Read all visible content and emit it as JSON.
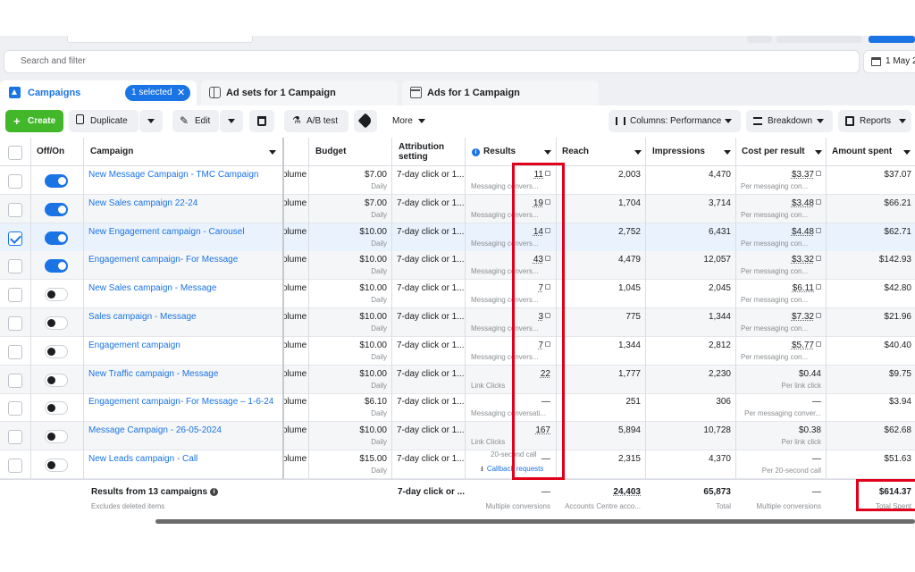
{
  "search": {
    "placeholder": "Search and filter",
    "date_label": "1 May 2"
  },
  "tabs": {
    "campaigns": "Campaigns",
    "selected_badge": "1 selected",
    "close_symbol": "✕",
    "adsets": "Ad sets for 1 Campaign",
    "ads": "Ads for 1 Campaign"
  },
  "toolbar": {
    "create": "Create",
    "duplicate": "Duplicate",
    "edit": "Edit",
    "ab_test": "A/B test",
    "more": "More",
    "columns": "Columns: Performance",
    "breakdown": "Breakdown",
    "reports": "Reports"
  },
  "headers": {
    "offon": "Off/On",
    "campaign": "Campaign",
    "budget": "Budget",
    "attribution": "Attribution setting",
    "results": "Results",
    "reach": "Reach",
    "impressions": "Impressions",
    "cost": "Cost per result",
    "amount": "Amount spent"
  },
  "rows": [
    {
      "name": "New Message Campaign - TMC Campaign",
      "toggle": true,
      "checked": false,
      "obj": "olume",
      "budget": "$7.00",
      "budget_type": "Daily",
      "attribution": "7-day click or 1...",
      "results": "11",
      "results_sub": "Messaging convers...",
      "reach": "2,003",
      "impressions": "4,470",
      "cost": "$3.37",
      "cost_sub": "Per messaging con...",
      "amount": "$37.07"
    },
    {
      "name": "New Sales campaign 22-24",
      "toggle": true,
      "checked": false,
      "obj": "olume",
      "budget": "$7.00",
      "budget_type": "Daily",
      "attribution": "7-day click or 1...",
      "results": "19",
      "results_sub": "Messaging convers...",
      "reach": "1,704",
      "impressions": "3,714",
      "cost": "$3.48",
      "cost_sub": "Per messaging con...",
      "amount": "$66.21"
    },
    {
      "name": "New Engagement campaign - Carousel",
      "toggle": true,
      "checked": true,
      "obj": "olume",
      "budget": "$10.00",
      "budget_type": "Daily",
      "attribution": "7-day click or 1...",
      "results": "14",
      "results_sub": "Messaging convers...",
      "reach": "2,752",
      "impressions": "6,431",
      "cost": "$4.48",
      "cost_sub": "Per messaging con...",
      "amount": "$62.71"
    },
    {
      "name": "Engagement campaign- For Message",
      "toggle": true,
      "checked": false,
      "obj": "olume",
      "budget": "$10.00",
      "budget_type": "Daily",
      "attribution": "7-day click or 1...",
      "results": "43",
      "results_sub": "Messaging convers...",
      "reach": "4,479",
      "impressions": "12,057",
      "cost": "$3.32",
      "cost_sub": "Per messaging con...",
      "amount": "$142.93"
    },
    {
      "name": "New Sales campaign - Message",
      "toggle": false,
      "checked": false,
      "obj": "olume",
      "budget": "$10.00",
      "budget_type": "Daily",
      "attribution": "7-day click or 1...",
      "results": "7",
      "results_sub": "Messaging convers...",
      "reach": "1,045",
      "impressions": "2,045",
      "cost": "$6.11",
      "cost_sub": "Per messaging con...",
      "amount": "$42.80"
    },
    {
      "name": "Sales campaign - Message",
      "toggle": false,
      "checked": false,
      "obj": "olume",
      "budget": "$10.00",
      "budget_type": "Daily",
      "attribution": "7-day click or 1...",
      "results": "3",
      "results_sub": "Messaging convers...",
      "reach": "775",
      "impressions": "1,344",
      "cost": "$7.32",
      "cost_sub": "Per messaging con...",
      "amount": "$21.96"
    },
    {
      "name": "Engagement campaign",
      "toggle": false,
      "checked": false,
      "obj": "olume",
      "budget": "$10.00",
      "budget_type": "Daily",
      "attribution": "7-day click or 1...",
      "results": "7",
      "results_sub": "Messaging convers...",
      "reach": "1,344",
      "impressions": "2,812",
      "cost": "$5.77",
      "cost_sub": "Per messaging con...",
      "amount": "$40.40"
    },
    {
      "name": "New Traffic campaign - Message",
      "toggle": false,
      "checked": false,
      "obj": "olume",
      "budget": "$10.00",
      "budget_type": "Daily",
      "attribution": "7-day click or 1...",
      "results": "22",
      "results_sub": "Link Clicks",
      "reach": "1,777",
      "impressions": "2,230",
      "cost": "$0.44",
      "cost_sub": "Per link click",
      "amount": "$9.75"
    },
    {
      "name": "Engagement campaign- For Message – 1-6-24",
      "toggle": false,
      "checked": false,
      "obj": "olume",
      "budget": "$6.10",
      "budget_type": "Daily",
      "attribution": "7-day click or 1...",
      "results": "—",
      "results_sub": "Messaging conversati...",
      "reach": "251",
      "impressions": "306",
      "cost": "—",
      "cost_sub": "Per messaging conver...",
      "amount": "$3.94"
    },
    {
      "name": "Message Campaign - 26-05-2024",
      "toggle": false,
      "checked": false,
      "obj": "olume",
      "budget": "$10.00",
      "budget_type": "Daily",
      "attribution": "7-day click or 1...",
      "results": "167",
      "results_sub": "Link Clicks",
      "reach": "5,894",
      "impressions": "10,728",
      "cost": "$0.38",
      "cost_sub": "Per link click",
      "amount": "$62.68"
    },
    {
      "name": "New Leads campaign - Call",
      "toggle": false,
      "checked": false,
      "obj": "olume",
      "budget": "$15.00",
      "budget_type": "Daily",
      "attribution": "7-day click or 1...",
      "results": "—",
      "results_sub": "20-second call",
      "results_extra": "Callback requests",
      "reach": "2,315",
      "impressions": "4,370",
      "cost": "—",
      "cost_sub": "Per 20-second call",
      "amount": "$51.63"
    }
  ],
  "totals": {
    "label": "Results from 13 campaigns",
    "sub": "Excludes deleted items",
    "attribution": "7-day click or ...",
    "results": "—",
    "results_sub": "Multiple conversions",
    "reach": "24,403",
    "reach_sub": "Accounts Centre acco...",
    "impressions": "65,873",
    "impressions_sub": "Total",
    "cost": "—",
    "cost_sub": "Multiple conversions",
    "amount": "$614.37",
    "amount_sub": "Total Spent"
  },
  "colors": {
    "accent": "#1b74e4",
    "create": "#42b72a",
    "highlight": "#e0001b"
  },
  "icons": [
    "calendar-icon",
    "campaign-icon",
    "adsets-icon",
    "ads-icon",
    "plus-icon",
    "duplicate-icon",
    "pencil-icon",
    "trash-icon",
    "flask-icon",
    "tag-icon",
    "columns-icon",
    "breakdown-icon",
    "reports-icon",
    "info-icon",
    "download-icon"
  ]
}
